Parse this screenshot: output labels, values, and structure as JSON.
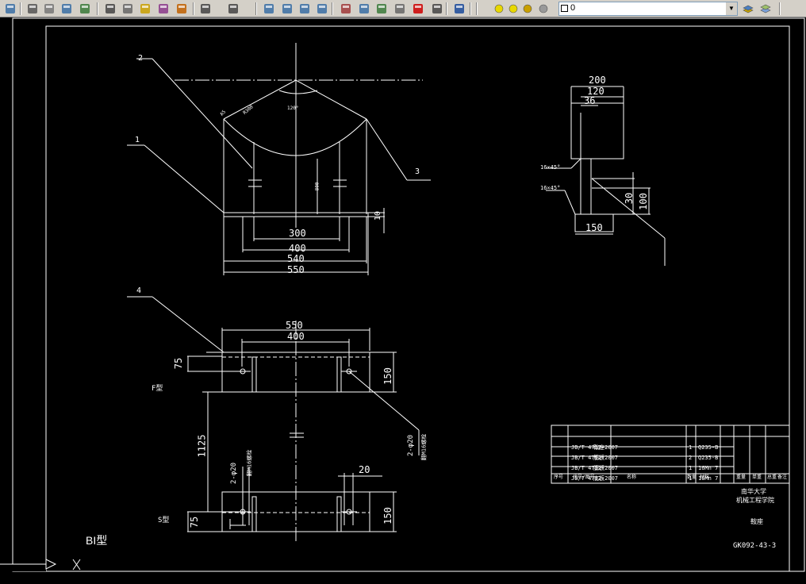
{
  "toolbar": {
    "buttons": [
      "save-icon",
      "print-icon",
      "print-preview-icon",
      "publish-icon",
      "web-icon",
      "cut-icon",
      "copy-icon",
      "paste-icon",
      "match-properties-icon",
      "brush-icon",
      "undo-icon",
      "redo-icon",
      "pan-icon",
      "zoom-realtime-icon",
      "zoom-window-icon",
      "zoom-previous-icon",
      "properties-icon",
      "design-center-icon",
      "tool-palettes-icon",
      "sheet-set-icon",
      "markup-icon",
      "calculator-icon",
      "help-icon"
    ],
    "layer_name": "0"
  },
  "drawing": {
    "dims_front": [
      "300",
      "400",
      "540",
      "550",
      "10"
    ],
    "dims_top": [
      "550",
      "400",
      "150",
      "75",
      "1125",
      "150",
      "75",
      "20"
    ],
    "dims_side": [
      "200",
      "120",
      "36",
      "30",
      "100",
      "150"
    ],
    "small_front": [
      "R255",
      "R300",
      "120°",
      "800",
      "A5"
    ],
    "chamfers": [
      "16×45°",
      "16×45°"
    ],
    "leaders": [
      "2",
      "1",
      "3",
      "4"
    ],
    "labels": [
      "F型",
      "S型",
      "BI型"
    ],
    "holes": [
      "2-φ20",
      "翻M16螺栓",
      "2-φ20",
      "翻M16螺栓"
    ],
    "title_block": {
      "rows": [
        {
          "code": "JB/T 4712-2007",
          "name": "鞍座",
          "qty": "1",
          "mat": "Q235-B"
        },
        {
          "code": "JB/T 4712-2007",
          "name": "筋板",
          "qty": "2",
          "mat": "Q235-B"
        },
        {
          "code": "JB/T 4712-2007",
          "name": "腹板",
          "qty": "1",
          "mat": "16Mn 7"
        },
        {
          "code": "JB/T 4712-2007",
          "name": "底板",
          "qty": "1",
          "mat": "16Mn 7"
        }
      ],
      "header": [
        "序号",
        "代号/图号",
        "名称",
        "数量",
        "材料",
        "重量",
        "单重",
        "总重",
        "备注"
      ],
      "school": "南华大学",
      "dept": "机械工程学院",
      "part": "鞍座",
      "code": "GK092-43-3"
    }
  },
  "colors": {
    "bg": "#000000",
    "line": "#ffffff",
    "toolbar": "#d4d0c8"
  }
}
